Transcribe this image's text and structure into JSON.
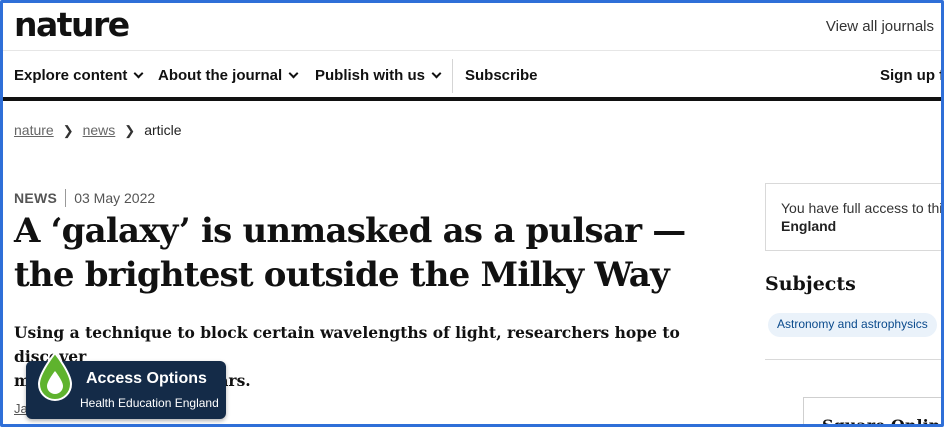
{
  "header": {
    "logo": "nature",
    "view_all_journals": "View all journals"
  },
  "nav": {
    "items": [
      {
        "label": "Explore content"
      },
      {
        "label": "About the journal"
      },
      {
        "label": "Publish with us"
      },
      {
        "label": "Subscribe"
      },
      {
        "label": "Sign up f"
      }
    ]
  },
  "breadcrumb": {
    "items": [
      "nature",
      "news",
      "article"
    ]
  },
  "article": {
    "type": "NEWS",
    "date": "03 May 2022",
    "title_line1": "A ‘galaxy’ is unmasked as a pulsar —",
    "title_line2": "the brightest outside the Milky Way",
    "standfirst_line1": "Using a technique to block certain wavelengths of light, researchers hope to discover",
    "standfirst_line2": "many more hidden pulsars.",
    "author_stub": "Ja"
  },
  "sidebar": {
    "access_text": "You have full access to this",
    "access_org": "England",
    "subjects_title": "Subjects",
    "subject_tag": "Astronomy and astrophysics",
    "box_title": "Square Online"
  },
  "access_options": {
    "title": "Access Options",
    "subtitle": "Health Education England",
    "icon": "droplet-icon",
    "colors": {
      "bg": "#142b48",
      "drop": "#5fb32e"
    }
  },
  "colors": {
    "frame": "#2f6fd8",
    "link_blue": "#0a4a8c"
  }
}
